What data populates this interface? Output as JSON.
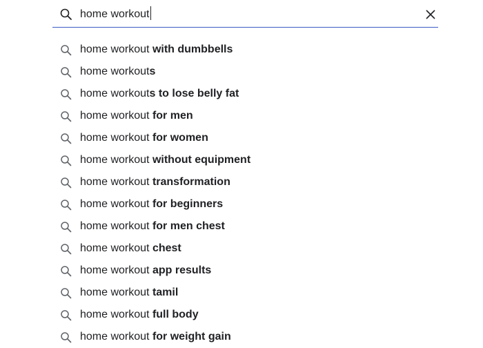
{
  "search": {
    "query": "home workout",
    "icon": "search-icon",
    "clear_icon": "close-icon",
    "accent_color": "#3b5bc4"
  },
  "suggestions": [
    {
      "prefix": "home workout",
      "completion": " with dumbbells"
    },
    {
      "prefix": "home workout",
      "completion": "s"
    },
    {
      "prefix": "home workout",
      "completion": "s to lose belly fat"
    },
    {
      "prefix": "home workout",
      "completion": " for men"
    },
    {
      "prefix": "home workout",
      "completion": " for women"
    },
    {
      "prefix": "home workout",
      "completion": " without equipment"
    },
    {
      "prefix": "home workout",
      "completion": " transformation"
    },
    {
      "prefix": "home workout",
      "completion": " for beginners"
    },
    {
      "prefix": "home workout",
      "completion": " for men chest"
    },
    {
      "prefix": "home workout",
      "completion": " chest"
    },
    {
      "prefix": "home workout",
      "completion": " app results"
    },
    {
      "prefix": "home workout",
      "completion": " tamil"
    },
    {
      "prefix": "home workout",
      "completion": " full body"
    },
    {
      "prefix": "home workout",
      "completion": " for weight gain"
    }
  ]
}
